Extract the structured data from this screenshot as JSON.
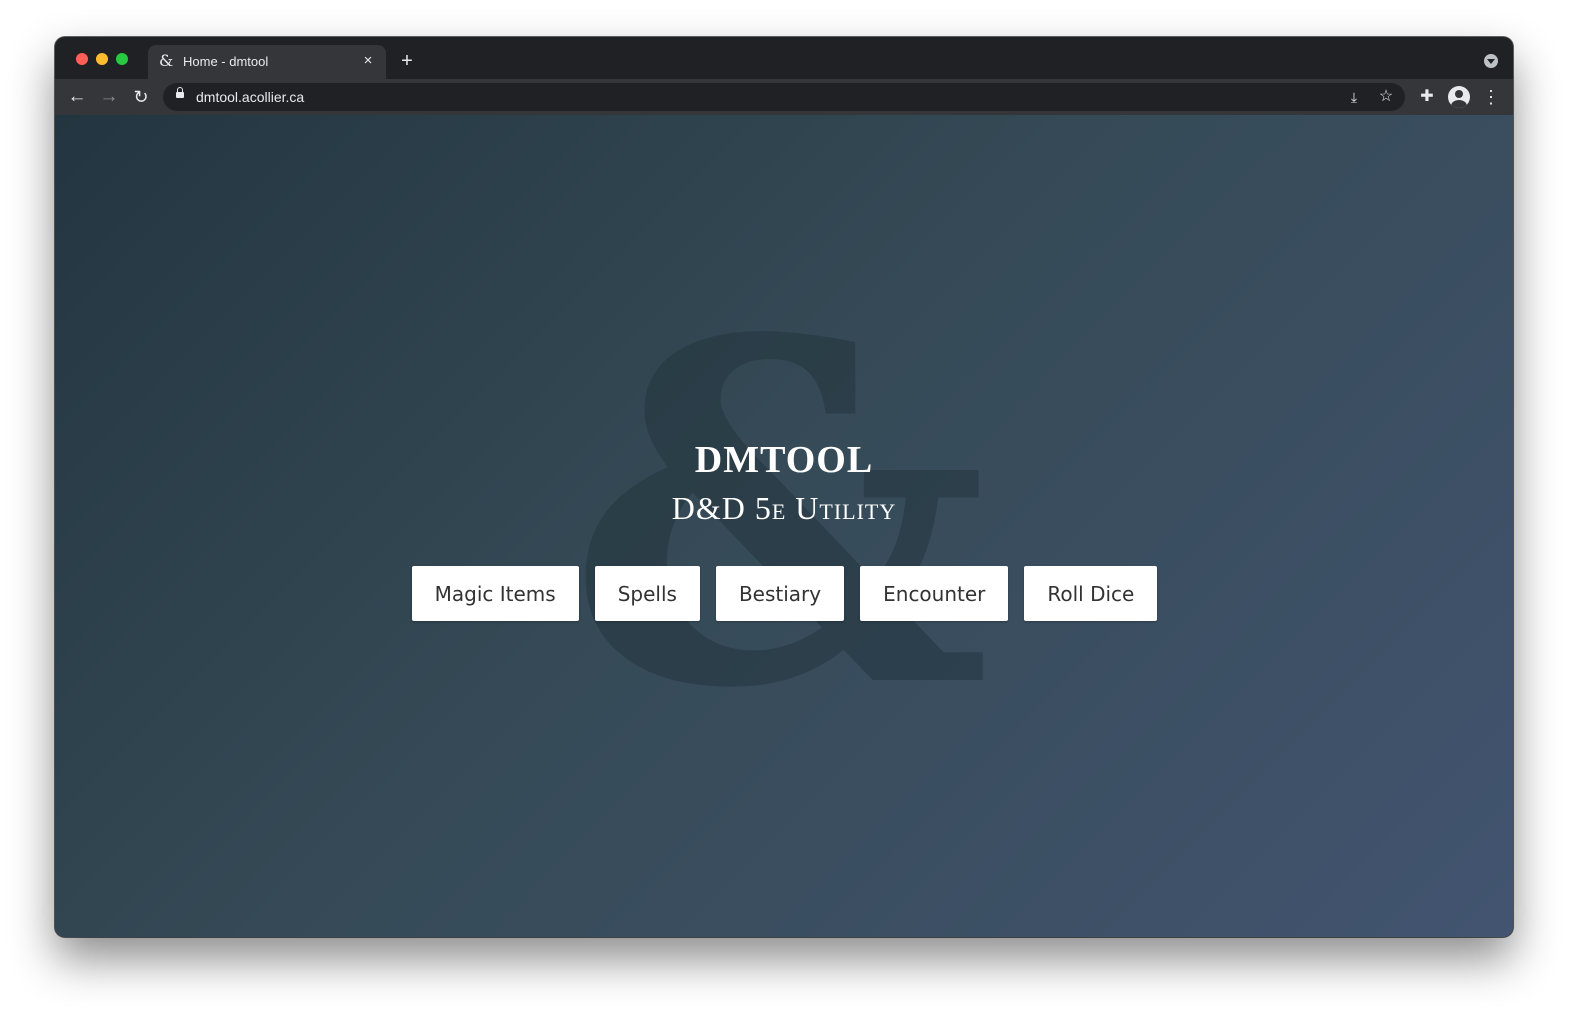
{
  "browser": {
    "tab": {
      "favicon": "ampersand-icon",
      "title": "Home - dmtool",
      "close": "×"
    },
    "new_tab": "+",
    "toolbar": {
      "back": "←",
      "forward": "→",
      "reload": "↻",
      "url": "dmtool.acollier.ca",
      "install_icon": "⤓",
      "star_icon": "☆",
      "extensions_icon": "✚",
      "menu_icon": "⋮"
    }
  },
  "page": {
    "background_glyph": "&",
    "title": "DMTOOL",
    "subtitle": "D&D 5e Utility",
    "buttons": [
      {
        "label": "Magic Items"
      },
      {
        "label": "Spells"
      },
      {
        "label": "Bestiary"
      },
      {
        "label": "Encounter"
      },
      {
        "label": "Roll Dice"
      }
    ]
  },
  "colors": {
    "browser_frame": "#202124",
    "toolbar": "#35363a",
    "gradient_start": "#233540",
    "gradient_end": "#425470",
    "button_bg": "#ffffff",
    "button_text": "#333333"
  }
}
